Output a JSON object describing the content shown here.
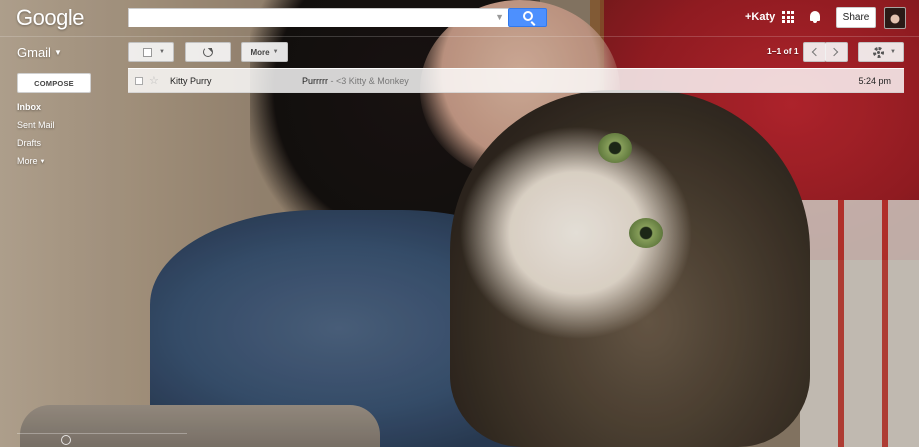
{
  "header": {
    "logo_text": "Google",
    "search": {
      "value": "",
      "placeholder": ""
    },
    "user_link": "+Katy",
    "share_label": "Share"
  },
  "sidebar": {
    "app_label": "Gmail",
    "compose_label": "COMPOSE",
    "items": [
      {
        "label": "Inbox",
        "active": true
      },
      {
        "label": "Sent Mail",
        "active": false
      },
      {
        "label": "Drafts",
        "active": false
      },
      {
        "label": "More",
        "active": false
      }
    ]
  },
  "toolbar": {
    "more_label": "More",
    "pager_text": "1–1 of 1"
  },
  "messages": [
    {
      "sender": "Kitty Purry",
      "subject": "Purrrrr",
      "snippet": " - <3 Kitty & Monkey",
      "time": "5:24 pm"
    }
  ],
  "colors": {
    "search_button": "#4d90fe",
    "text_on_theme": "#ffffff"
  },
  "icons": [
    "search-icon",
    "apps-icon",
    "bell-icon",
    "refresh-icon",
    "chevron-left-icon",
    "chevron-right-icon",
    "gear-icon",
    "star-icon",
    "checkbox-icon",
    "chat-icon"
  ]
}
